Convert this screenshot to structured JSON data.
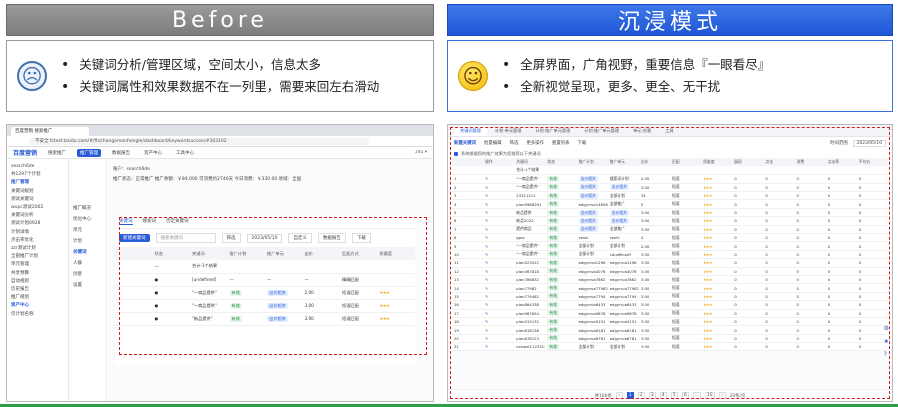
{
  "before": {
    "title": "Before",
    "bullets": [
      "关键词分析/管理区域，空间太小，信息太多",
      "关键词属性和效果数据不在一列里，需要来回左右滑动"
    ],
    "browser": {
      "tab": "百度营销 搜索推广",
      "url": "不安全  fctest.baidu.com/#/fh/changemanhengle/dashboard/keywordsuccess#303102"
    },
    "app": {
      "logo": "百度营销",
      "nav": [
        "搜索推广",
        "推广管理",
        "数据报告",
        "资产中心",
        "工具中心"
      ],
      "active_nav": "推广管理",
      "right": "zdu ▾"
    },
    "sidebar": [
      "search6de",
      "共1297个计划",
      "推广管理",
      "关键词规划",
      "测试关键词",
      "wupc测试2002",
      "关键词分析",
      "测试计划0928",
      "计划详情",
      "点击率优化",
      "zzr测试计划",
      "全部推广计划",
      "单元管理",
      "共享预算",
      "自动规则",
      "历史报告",
      "推广规划",
      "资产中心",
      "仅计划名称"
    ],
    "midnav": [
      "推广概况",
      "优化中心",
      "单元",
      "计划",
      "关键词",
      "人群",
      "创意",
      "设置"
    ],
    "midnav_active": "关键词",
    "info_lines": [
      "账户：search6de",
      "推广状态：正常推广  推广余额：￥84,000  可消费约2746天  今日消费：￥330.00  地域：全国"
    ],
    "inner": {
      "tabs": [
        "关键词",
        "搜索词",
        "否定关键词"
      ],
      "active_tab": "关键词",
      "add_button": "新建关键词",
      "search_placeholder": "搜索关键词",
      "filter": "筛选",
      "date": "2023/05/10",
      "custom": "自定义",
      "report": "数据报告",
      "download": "下载",
      "columns": [
        "",
        "状态",
        "关键词",
        "推广计划",
        "推广单元",
        "出价",
        "匹配方式",
        "质量度"
      ],
      "rows": [
        [
          "",
          "—",
          "合计-1个结果",
          "",
          "",
          "",
          "",
          ""
        ],
        [
          "",
          "●",
          "[undefined]",
          "—",
          "—",
          "—",
          "精确匹配",
          ""
        ],
        [
          "",
          "●",
          "\"一商品提供\"",
          "有效",
          "出价相关",
          "2.00",
          "短语匹配",
          "★★★"
        ],
        [
          "",
          "●",
          "\"一商品提供\"",
          "有效",
          "出价相关",
          "3.00",
          "短语匹配",
          "★★★"
        ],
        [
          "",
          "●",
          "\"新品提供\"",
          "有效",
          "出价相关",
          "3.00",
          "短语匹配",
          "★★★"
        ]
      ]
    }
  },
  "after": {
    "title": "沉浸模式",
    "bullets": [
      "全屏界面，广角视野，重要信息『一眼看尽』",
      "全新视觉呈现，更多、更全、无干扰"
    ],
    "tabs": [
      "关键词管理",
      "计划·单元管理",
      "计划·推广单元管理",
      "计划·推广单元管理",
      "单元·创意",
      "工具"
    ],
    "active_tab": "关键词管理",
    "toolbar": {
      "add": "新建关键词",
      "items": [
        "批量编辑",
        "筛选",
        "更多操作",
        "重置列表",
        "下载"
      ],
      "date_label": "时间范围",
      "date": "2023/05/10"
    },
    "notice": "系统根据您的推广效果为您推荐以下关键词",
    "columns": [
      "",
      "操作",
      "关键词",
      "状态",
      "推广计划",
      "推广单元",
      "出价",
      "匹配",
      "质量度",
      "展现",
      "点击",
      "消费",
      "点击率",
      "平均价"
    ],
    "rows": [
      [
        "",
        "",
        "合计-1个结果",
        "",
        "",
        "",
        "",
        "",
        "",
        "",
        "",
        "",
        "",
        ""
      ],
      [
        "1",
        "✎",
        "\"一商品提供\"",
        "有效",
        "出价相关",
        "搜索词计划",
        "2.00",
        "短语",
        "★★★",
        "0",
        "0",
        "0",
        "0",
        "0"
      ],
      [
        "2",
        "✎",
        "\"一商品提供\"",
        "有效",
        "出价相关",
        "出价相关",
        "3.00",
        "短语",
        "★★★",
        "0",
        "0",
        "0",
        "0",
        "0"
      ],
      [
        "3",
        "✎",
        "23311211",
        "有效",
        "出价相关",
        "全部计划",
        "34",
        "短语",
        "★★★",
        "0",
        "0",
        "0",
        "0",
        "0"
      ],
      [
        "4",
        "✎",
        "plan9988261",
        "有效",
        "edgyrrua14856",
        "全部推广",
        "5",
        "短语",
        "★★★",
        "0",
        "0",
        "0",
        "0",
        "0"
      ],
      [
        "5",
        "✎",
        "新品提供",
        "有效",
        "出价相关",
        "出价相关",
        "3.00",
        "短语",
        "★★★",
        "0",
        "0",
        "0",
        "0",
        "0"
      ],
      [
        "6",
        "✎",
        "新品2022",
        "有效",
        "出价相关",
        "出价相关",
        "3.00",
        "短语",
        "★★★",
        "0",
        "0",
        "0",
        "0",
        "0"
      ],
      [
        "7",
        "✎",
        "提供商品",
        "有效",
        "出价相关",
        "全部推广",
        "3.00",
        "短语",
        "★★★",
        "0",
        "0",
        "0",
        "0",
        "0"
      ],
      [
        "8",
        "✎",
        "gpsc",
        "有效",
        "ceshi",
        "ceshi",
        "4",
        "短语",
        "★★★",
        "0",
        "0",
        "0",
        "0",
        "0"
      ],
      [
        "9",
        "✎",
        "\"一商品提供\"",
        "有效",
        "全部计划",
        "全部计划",
        "2.00",
        "短语",
        "★★★",
        "0",
        "0",
        "0",
        "0",
        "0"
      ],
      [
        "10",
        "✎",
        "\"一商品提供\"",
        "有效",
        "全部计划",
        "cdudfikuuff",
        "3.00",
        "短语",
        "★★★",
        "0",
        "0",
        "0",
        "0",
        "0"
      ],
      [
        "11",
        "✎",
        "plan523022",
        "有效",
        "edgyrrua1296",
        "edgyrrua1296",
        "3.00",
        "短语",
        "★★★",
        "0",
        "0",
        "0",
        "0",
        "0"
      ],
      [
        "12",
        "✎",
        "plan467818",
        "有效",
        "edgyrrua4076",
        "edgyrrua4076",
        "3.00",
        "短语",
        "★★★",
        "0",
        "0",
        "0",
        "0",
        "0"
      ],
      [
        "13",
        "✎",
        "plan786832",
        "有效",
        "edgyrrua7862",
        "edgyrrua7862",
        "3.00",
        "短语",
        "★★★",
        "0",
        "0",
        "0",
        "0",
        "0"
      ],
      [
        "14",
        "✎",
        "plan77982",
        "有效",
        "edgyrrua77982",
        "edgyrrua77982",
        "3.00",
        "短语",
        "★★★",
        "0",
        "0",
        "0",
        "0",
        "0"
      ],
      [
        "15",
        "✎",
        "plan779482",
        "有效",
        "edgyrrua7794",
        "edgyrrua7794",
        "3.00",
        "短语",
        "★★★",
        "0",
        "0",
        "0",
        "0",
        "0"
      ],
      [
        "16",
        "✎",
        "plan864338",
        "有效",
        "edgyrrua6433",
        "edgyrrua6433",
        "3.00",
        "短语",
        "★★★",
        "0",
        "0",
        "0",
        "0",
        "0"
      ],
      [
        "17",
        "✎",
        "plan987654",
        "有效",
        "edgyrrua9876",
        "edgyrrua9876",
        "3.00",
        "短语",
        "★★★",
        "0",
        "0",
        "0",
        "0",
        "0"
      ],
      [
        "18",
        "✎",
        "plan515132",
        "有效",
        "edgyrrua5151",
        "edgyrrua5151",
        "3.00",
        "短语",
        "★★★",
        "0",
        "0",
        "0",
        "0",
        "0"
      ],
      [
        "19",
        "✎",
        "plan618138",
        "有效",
        "edgyrrua6181",
        "edgyrrua6181",
        "3.00",
        "短语",
        "★★★",
        "0",
        "0",
        "0",
        "0",
        "0"
      ],
      [
        "20",
        "✎",
        "plan878123",
        "有效",
        "edgyrrua8781",
        "edgyrrua8781",
        "3.00",
        "短语",
        "★★★",
        "0",
        "0",
        "0",
        "0",
        "0"
      ],
      [
        "21",
        "✎",
        "cenwei1123313",
        "有效",
        "全部计划",
        "全部计划",
        "3.00",
        "短语",
        "★★★",
        "0",
        "0",
        "0",
        "0",
        "0"
      ]
    ],
    "pagination": {
      "total": "共100条",
      "pages": [
        "1",
        "2",
        "3",
        "4",
        "5",
        "6",
        "...",
        "10"
      ],
      "active": "1",
      "size": "20条/页"
    },
    "float": [
      "⚙",
      "★",
      "?"
    ]
  }
}
